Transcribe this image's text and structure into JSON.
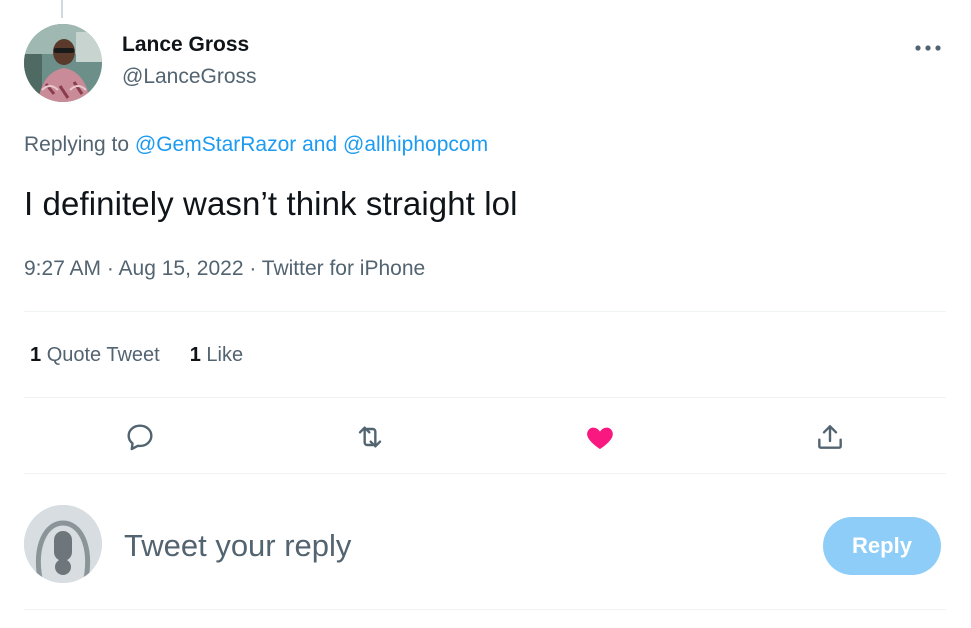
{
  "tweet": {
    "author": {
      "display_name": "Lance Gross",
      "handle": "@LanceGross"
    },
    "replying_prefix": "Replying to",
    "replying_to": [
      "@GemStarRazor",
      "@allhiphopcom"
    ],
    "replying_joiner": "and",
    "text": "I definitely wasn’t think straight lol",
    "meta": "9:27 AM · Aug 15, 2022 · Twitter for iPhone"
  },
  "stats": {
    "quote_count": "1",
    "quote_label": "Quote Tweet",
    "like_count": "1",
    "like_label": "Like"
  },
  "actions": [
    {
      "icon": "reply-icon"
    },
    {
      "icon": "retweet-icon"
    },
    {
      "icon": "heart-icon",
      "liked": true,
      "color": "#f91880"
    },
    {
      "icon": "share-icon"
    }
  ],
  "reply_box": {
    "placeholder": "Tweet your reply",
    "button_label": "Reply"
  },
  "colors": {
    "link": "#1d9bf0",
    "secondary_text": "#536471",
    "like_active": "#f91880",
    "reply_button_disabled": "#8ecdf8"
  }
}
